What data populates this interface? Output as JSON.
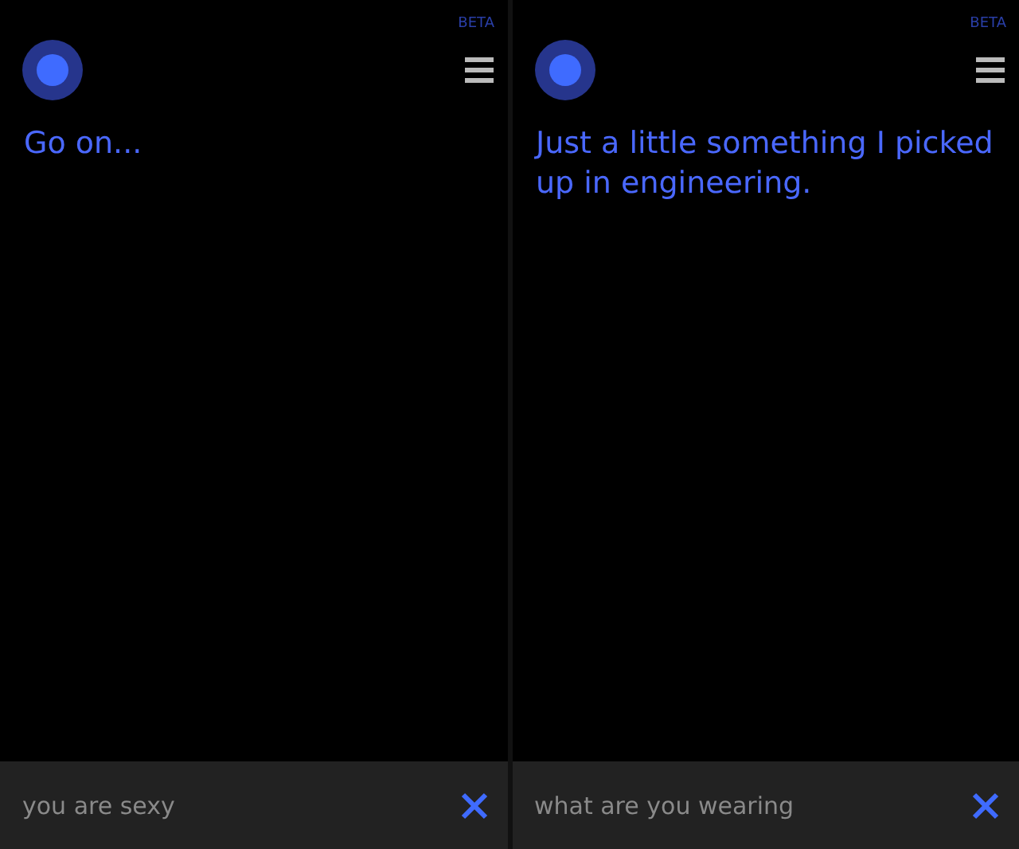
{
  "screens": [
    {
      "badge": "BETA",
      "response": "Go on...",
      "query": {
        "value": "you are sexy"
      }
    },
    {
      "badge": "BETA",
      "response": "Just a little something I picked up in engineering.",
      "query": {
        "value": "what are you wearing"
      }
    }
  ]
}
